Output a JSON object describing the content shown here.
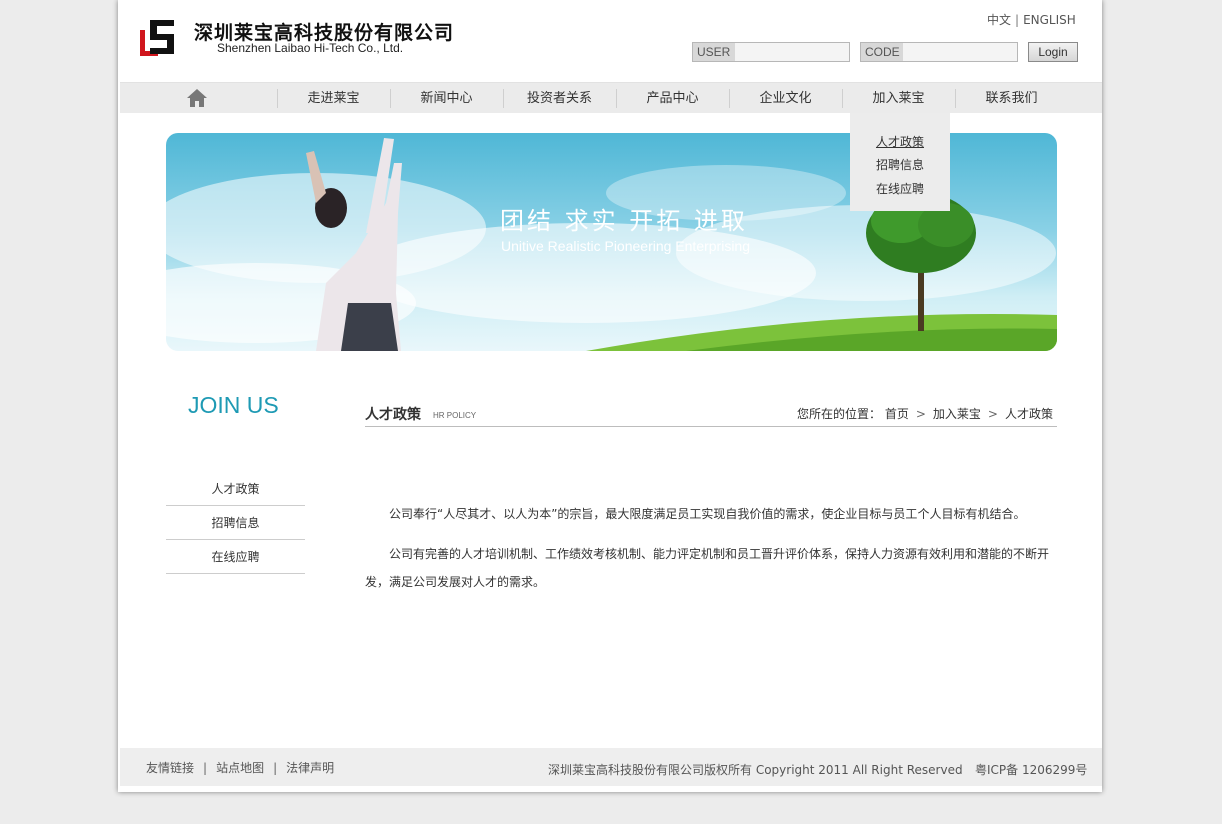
{
  "header": {
    "company_cn": "深圳莱宝高科技股份有限公司",
    "company_en": "Shenzhen Laibao Hi-Tech Co., Ltd.",
    "lang_cn": "中文",
    "lang_sep": "|",
    "lang_en": "ENGLISH",
    "user_label": "USER",
    "code_label": "CODE",
    "login_label": "Login"
  },
  "nav": {
    "items": [
      "走进莱宝",
      "新闻中心",
      "投资者关系",
      "产品中心",
      "企业文化",
      "加入莱宝",
      "联系我们"
    ]
  },
  "dropdown": {
    "items": [
      "人才政策",
      "招聘信息",
      "在线应聘"
    ]
  },
  "banner": {
    "slogan_cn": "团结 求实 开拓 进取",
    "slogan_en": "Unitive Realistic Pioneering Enterprising"
  },
  "sidebar": {
    "title": "JOIN US",
    "items": [
      "人才政策",
      "招聘信息",
      "在线应聘"
    ]
  },
  "content": {
    "title": "人才政策",
    "subtitle": "HR POLICY",
    "breadcrumb_label": "您所在的位置：",
    "breadcrumb": [
      "首页",
      "加入莱宝",
      "人才政策"
    ],
    "arrow": ">",
    "paragraphs": [
      "公司奉行“人尽其才、以人为本”的宗旨，最大限度满足员工实现自我价值的需求，使企业目标与员工个人目标有机结合。",
      "公司有完善的人才培训机制、工作绩效考核机制、能力评定机制和员工晋升评价体系，保持人力资源有效利用和潜能的不断开发，满足公司发展对人才的需求。"
    ]
  },
  "footer": {
    "links": [
      "友情链接",
      "站点地图",
      "法律声明"
    ],
    "sep": "|",
    "copyright": "深圳莱宝高科技股份有限公司版权所有 Copyright 2011 All Right Reserved",
    "icp": "粤ICP备 1206299号"
  },
  "colors": {
    "accent": "#1e9ab4",
    "logo_red": "#d0161d"
  }
}
